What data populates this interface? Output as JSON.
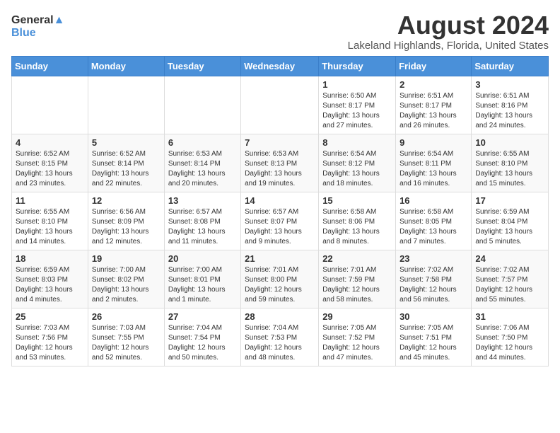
{
  "header": {
    "logo_general": "General",
    "logo_blue": "Blue",
    "month_year": "August 2024",
    "location": "Lakeland Highlands, Florida, United States"
  },
  "weekdays": [
    "Sunday",
    "Monday",
    "Tuesday",
    "Wednesday",
    "Thursday",
    "Friday",
    "Saturday"
  ],
  "weeks": [
    [
      {
        "day": "",
        "sunrise": "",
        "sunset": "",
        "daylight": ""
      },
      {
        "day": "",
        "sunrise": "",
        "sunset": "",
        "daylight": ""
      },
      {
        "day": "",
        "sunrise": "",
        "sunset": "",
        "daylight": ""
      },
      {
        "day": "",
        "sunrise": "",
        "sunset": "",
        "daylight": ""
      },
      {
        "day": "1",
        "sunrise": "Sunrise: 6:50 AM",
        "sunset": "Sunset: 8:17 PM",
        "daylight": "Daylight: 13 hours and 27 minutes."
      },
      {
        "day": "2",
        "sunrise": "Sunrise: 6:51 AM",
        "sunset": "Sunset: 8:17 PM",
        "daylight": "Daylight: 13 hours and 26 minutes."
      },
      {
        "day": "3",
        "sunrise": "Sunrise: 6:51 AM",
        "sunset": "Sunset: 8:16 PM",
        "daylight": "Daylight: 13 hours and 24 minutes."
      }
    ],
    [
      {
        "day": "4",
        "sunrise": "Sunrise: 6:52 AM",
        "sunset": "Sunset: 8:15 PM",
        "daylight": "Daylight: 13 hours and 23 minutes."
      },
      {
        "day": "5",
        "sunrise": "Sunrise: 6:52 AM",
        "sunset": "Sunset: 8:14 PM",
        "daylight": "Daylight: 13 hours and 22 minutes."
      },
      {
        "day": "6",
        "sunrise": "Sunrise: 6:53 AM",
        "sunset": "Sunset: 8:14 PM",
        "daylight": "Daylight: 13 hours and 20 minutes."
      },
      {
        "day": "7",
        "sunrise": "Sunrise: 6:53 AM",
        "sunset": "Sunset: 8:13 PM",
        "daylight": "Daylight: 13 hours and 19 minutes."
      },
      {
        "day": "8",
        "sunrise": "Sunrise: 6:54 AM",
        "sunset": "Sunset: 8:12 PM",
        "daylight": "Daylight: 13 hours and 18 minutes."
      },
      {
        "day": "9",
        "sunrise": "Sunrise: 6:54 AM",
        "sunset": "Sunset: 8:11 PM",
        "daylight": "Daylight: 13 hours and 16 minutes."
      },
      {
        "day": "10",
        "sunrise": "Sunrise: 6:55 AM",
        "sunset": "Sunset: 8:10 PM",
        "daylight": "Daylight: 13 hours and 15 minutes."
      }
    ],
    [
      {
        "day": "11",
        "sunrise": "Sunrise: 6:55 AM",
        "sunset": "Sunset: 8:10 PM",
        "daylight": "Daylight: 13 hours and 14 minutes."
      },
      {
        "day": "12",
        "sunrise": "Sunrise: 6:56 AM",
        "sunset": "Sunset: 8:09 PM",
        "daylight": "Daylight: 13 hours and 12 minutes."
      },
      {
        "day": "13",
        "sunrise": "Sunrise: 6:57 AM",
        "sunset": "Sunset: 8:08 PM",
        "daylight": "Daylight: 13 hours and 11 minutes."
      },
      {
        "day": "14",
        "sunrise": "Sunrise: 6:57 AM",
        "sunset": "Sunset: 8:07 PM",
        "daylight": "Daylight: 13 hours and 9 minutes."
      },
      {
        "day": "15",
        "sunrise": "Sunrise: 6:58 AM",
        "sunset": "Sunset: 8:06 PM",
        "daylight": "Daylight: 13 hours and 8 minutes."
      },
      {
        "day": "16",
        "sunrise": "Sunrise: 6:58 AM",
        "sunset": "Sunset: 8:05 PM",
        "daylight": "Daylight: 13 hours and 7 minutes."
      },
      {
        "day": "17",
        "sunrise": "Sunrise: 6:59 AM",
        "sunset": "Sunset: 8:04 PM",
        "daylight": "Daylight: 13 hours and 5 minutes."
      }
    ],
    [
      {
        "day": "18",
        "sunrise": "Sunrise: 6:59 AM",
        "sunset": "Sunset: 8:03 PM",
        "daylight": "Daylight: 13 hours and 4 minutes."
      },
      {
        "day": "19",
        "sunrise": "Sunrise: 7:00 AM",
        "sunset": "Sunset: 8:02 PM",
        "daylight": "Daylight: 13 hours and 2 minutes."
      },
      {
        "day": "20",
        "sunrise": "Sunrise: 7:00 AM",
        "sunset": "Sunset: 8:01 PM",
        "daylight": "Daylight: 13 hours and 1 minute."
      },
      {
        "day": "21",
        "sunrise": "Sunrise: 7:01 AM",
        "sunset": "Sunset: 8:00 PM",
        "daylight": "Daylight: 12 hours and 59 minutes."
      },
      {
        "day": "22",
        "sunrise": "Sunrise: 7:01 AM",
        "sunset": "Sunset: 7:59 PM",
        "daylight": "Daylight: 12 hours and 58 minutes."
      },
      {
        "day": "23",
        "sunrise": "Sunrise: 7:02 AM",
        "sunset": "Sunset: 7:58 PM",
        "daylight": "Daylight: 12 hours and 56 minutes."
      },
      {
        "day": "24",
        "sunrise": "Sunrise: 7:02 AM",
        "sunset": "Sunset: 7:57 PM",
        "daylight": "Daylight: 12 hours and 55 minutes."
      }
    ],
    [
      {
        "day": "25",
        "sunrise": "Sunrise: 7:03 AM",
        "sunset": "Sunset: 7:56 PM",
        "daylight": "Daylight: 12 hours and 53 minutes."
      },
      {
        "day": "26",
        "sunrise": "Sunrise: 7:03 AM",
        "sunset": "Sunset: 7:55 PM",
        "daylight": "Daylight: 12 hours and 52 minutes."
      },
      {
        "day": "27",
        "sunrise": "Sunrise: 7:04 AM",
        "sunset": "Sunset: 7:54 PM",
        "daylight": "Daylight: 12 hours and 50 minutes."
      },
      {
        "day": "28",
        "sunrise": "Sunrise: 7:04 AM",
        "sunset": "Sunset: 7:53 PM",
        "daylight": "Daylight: 12 hours and 48 minutes."
      },
      {
        "day": "29",
        "sunrise": "Sunrise: 7:05 AM",
        "sunset": "Sunset: 7:52 PM",
        "daylight": "Daylight: 12 hours and 47 minutes."
      },
      {
        "day": "30",
        "sunrise": "Sunrise: 7:05 AM",
        "sunset": "Sunset: 7:51 PM",
        "daylight": "Daylight: 12 hours and 45 minutes."
      },
      {
        "day": "31",
        "sunrise": "Sunrise: 7:06 AM",
        "sunset": "Sunset: 7:50 PM",
        "daylight": "Daylight: 12 hours and 44 minutes."
      }
    ]
  ]
}
